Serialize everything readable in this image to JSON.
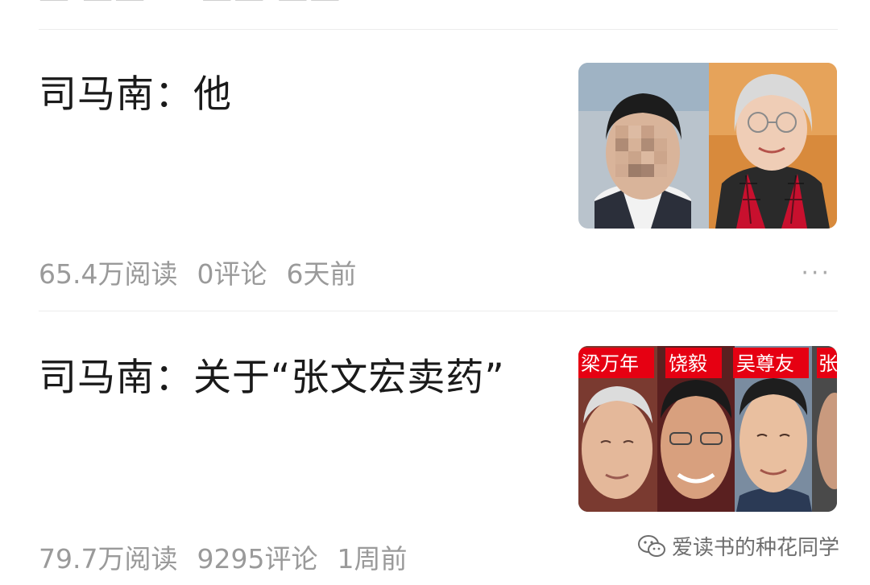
{
  "previous_item": {
    "title_fragment": "— —— 　 —— ——"
  },
  "articles": [
    {
      "title": "司马南：他",
      "reads": "65.4万阅读",
      "comments": "0评论",
      "time": "6天前",
      "more_label": "···"
    },
    {
      "title": "司马南：关于“张文宏卖药”",
      "reads": "79.7万阅读",
      "comments": "9295评论",
      "time": "1周前",
      "thumbnail_labels": [
        "梁万年",
        "饶毅",
        "吴尊友",
        "张"
      ]
    }
  ],
  "watermark": {
    "text": "爱读书的种花同学"
  },
  "colors": {
    "label_red": "#e60012",
    "meta_gray": "#9a9a9a",
    "title_black": "#1a1a1a"
  }
}
